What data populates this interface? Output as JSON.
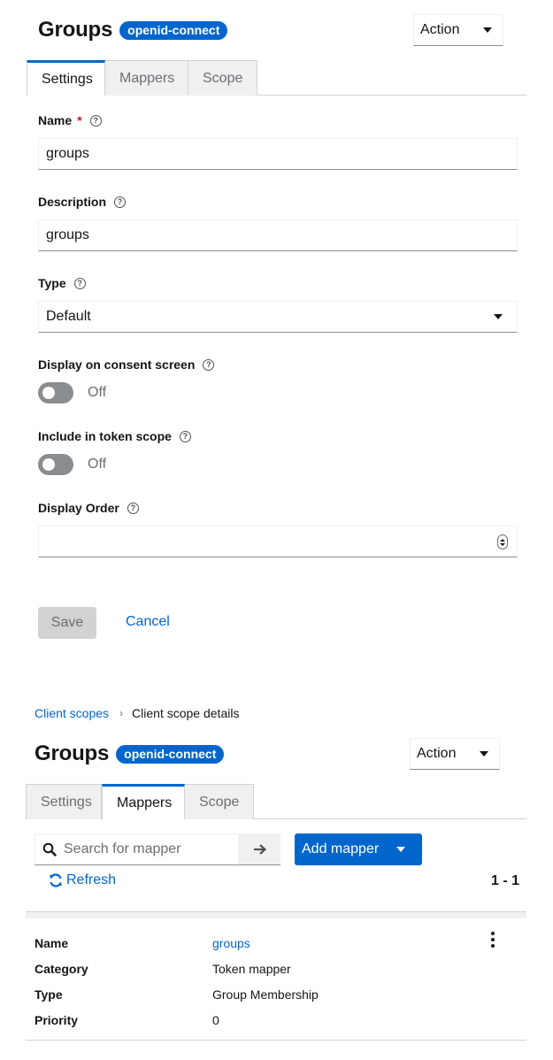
{
  "top": {
    "title": "Groups",
    "badge": "openid-connect",
    "action_label": "Action",
    "tabs": [
      {
        "label": "Settings"
      },
      {
        "label": "Mappers"
      },
      {
        "label": "Scope"
      }
    ],
    "form": {
      "name": {
        "label": "Name",
        "required_mark": "*",
        "value": "groups"
      },
      "description": {
        "label": "Description",
        "value": "groups"
      },
      "type": {
        "label": "Type",
        "value": "Default"
      },
      "consent": {
        "label": "Display on consent screen",
        "state": "Off"
      },
      "token_scope": {
        "label": "Include in token scope",
        "state": "Off"
      },
      "display_order": {
        "label": "Display Order",
        "value": ""
      }
    },
    "save_label": "Save",
    "cancel_label": "Cancel"
  },
  "bottom": {
    "breadcrumb": {
      "link": "Client scopes",
      "current": "Client scope details"
    },
    "title": "Groups",
    "badge": "openid-connect",
    "action_label": "Action",
    "tabs": [
      {
        "label": "Settings"
      },
      {
        "label": "Mappers"
      },
      {
        "label": "Scope"
      }
    ],
    "search_placeholder": "Search for mapper",
    "add_mapper_label": "Add mapper",
    "refresh_label": "Refresh",
    "pagination": "1 - 1",
    "mapper": {
      "name_key": "Name",
      "name_val": "groups",
      "category_key": "Category",
      "category_val": "Token mapper",
      "type_key": "Type",
      "type_val": "Group Membership",
      "priority_key": "Priority",
      "priority_val": "0"
    }
  },
  "colors": {
    "accent": "#0066cc",
    "required": "#c9190b",
    "toggle_off": "#8a8d90"
  }
}
